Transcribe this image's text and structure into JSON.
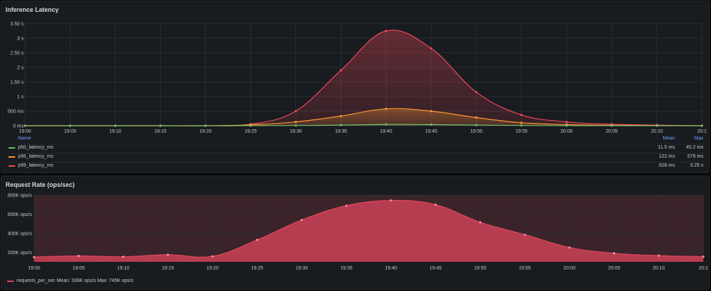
{
  "colors": {
    "p50": "#73bf69",
    "p95": "#ff9830",
    "p99": "#f2495c",
    "requests": "#e0475c",
    "grid": "#2a2d33"
  },
  "chart_data": [
    {
      "type": "area",
      "title": "Inference Latency",
      "x": [
        "19:00",
        "19:05",
        "19:10",
        "19:15",
        "19:20",
        "19:25",
        "19:30",
        "19:35",
        "19:40",
        "19:45",
        "19:50",
        "19:55",
        "20:00",
        "20:05",
        "20:10",
        "20:1"
      ],
      "yticks": [
        "0 ms",
        "500 ms",
        "1 s",
        "1.50 s",
        "2 s",
        "2.50 s",
        "3 s",
        "3.50 s"
      ],
      "ylim": [
        0,
        3.5
      ],
      "y_unit": "s",
      "grid": true,
      "legend": {
        "placement": "bottom",
        "headers": {
          "name": "Name",
          "mean": "Mean",
          "max": "Max"
        }
      },
      "series": [
        {
          "name": "p50_latency_ms",
          "color_key": "p50",
          "mean": "11.5 ms",
          "max": "45.2 ms",
          "values": [
            0,
            0,
            0,
            0,
            0,
            0.002,
            0.008,
            0.02,
            0.045,
            0.038,
            0.02,
            0.008,
            0.003,
            0.001,
            0,
            0
          ]
        },
        {
          "name": "p95_latency_ms",
          "color_key": "p95",
          "mean": "122 ms",
          "max": "579 ms",
          "values": [
            0,
            0,
            0,
            0,
            0,
            0.03,
            0.13,
            0.33,
            0.579,
            0.5,
            0.28,
            0.1,
            0.04,
            0.015,
            0.005,
            0
          ]
        },
        {
          "name": "p99_latency_ms",
          "color_key": "p99",
          "mean": "628 ms",
          "max": "3.25 s",
          "values": [
            0,
            0,
            0,
            0,
            0,
            0.05,
            0.5,
            1.9,
            3.25,
            2.65,
            1.15,
            0.37,
            0.13,
            0.05,
            0.02,
            0
          ]
        }
      ]
    },
    {
      "type": "area",
      "title": "Request Rate (ops/sec)",
      "x": [
        "19:00",
        "19:05",
        "19:10",
        "19:15",
        "19:20",
        "19:25",
        "19:30",
        "19:35",
        "19:40",
        "19:45",
        "19:50",
        "19:55",
        "20:00",
        "20:05",
        "20:10",
        "20:1"
      ],
      "yticks": [
        "200K ops/s",
        "400K ops/s",
        "600K ops/s",
        "800K ops/s"
      ],
      "ytick_values": [
        200000,
        400000,
        600000,
        800000
      ],
      "ylim": [
        100000,
        800000
      ],
      "grid": true,
      "legend": {
        "placement": "bottom"
      },
      "series": [
        {
          "name": "requests_per_sec",
          "color_key": "requests",
          "legend_text": "requests_per_sec  Mean: 339K ops/s  Max: 745K ops/s",
          "values": [
            150000,
            162000,
            153000,
            175000,
            158000,
            330000,
            540000,
            690000,
            745000,
            700000,
            515000,
            385000,
            250000,
            190000,
            165000,
            155000
          ]
        }
      ]
    }
  ]
}
